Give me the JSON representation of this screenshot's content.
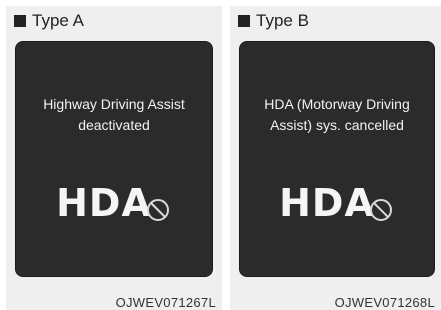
{
  "panels": [
    {
      "heading": "Type A",
      "message_lines": [
        "Highway Driving Assist",
        "deactivated"
      ],
      "symbol_text": "HDA",
      "symbol_icon": "cancelled-circle-icon",
      "code": "OJWEV071267L"
    },
    {
      "heading": "Type B",
      "message_lines": [
        "HDA (Motorway Driving",
        "Assist) sys. cancelled"
      ],
      "symbol_text": "HDA",
      "symbol_icon": "cancelled-circle-icon",
      "code": "OJWEV071268L"
    }
  ],
  "colors": {
    "panel_bg": "#efefef",
    "screen_bg": "#2b2b2b",
    "screen_text": "#f2f2f2"
  }
}
